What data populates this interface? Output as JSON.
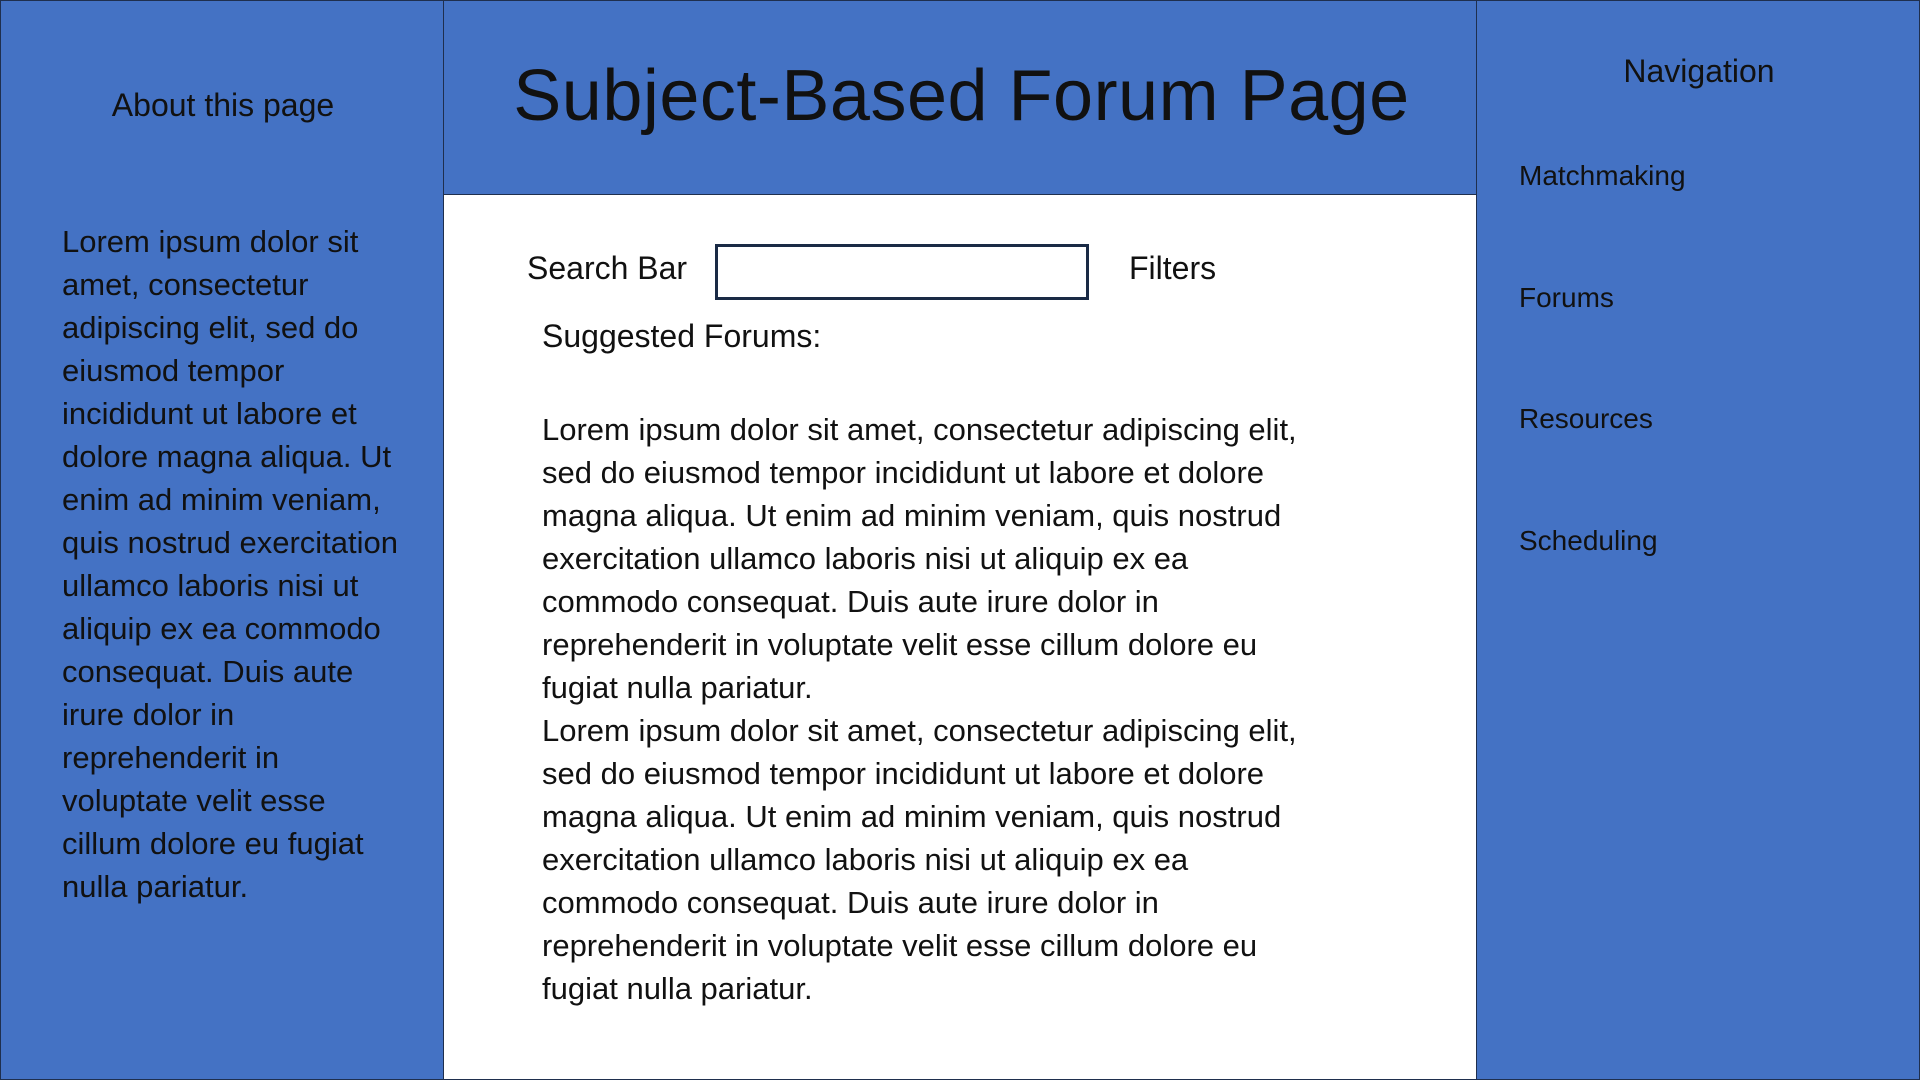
{
  "left_panel": {
    "title": "About this page",
    "body": "Lorem ipsum dolor sit amet, consectetur adipiscing elit, sed do eiusmod tempor incididunt ut labore et dolore magna aliqua. Ut enim ad minim veniam, quis nostrud exercitation ullamco laboris nisi ut aliquip ex ea commodo consequat. Duis aute irure dolor in reprehenderit in voluptate velit esse cillum dolore eu fugiat nulla pariatur."
  },
  "header": {
    "title": "Subject-Based Forum Page"
  },
  "main": {
    "search_label": "Search Bar",
    "search_value": "",
    "filters_label": "Filters",
    "suggested_heading": "Suggested Forums:",
    "suggested_items": [
      "Lorem ipsum dolor sit amet, consectetur adipiscing elit, sed do eiusmod tempor incididunt ut labore et dolore magna aliqua. Ut enim ad minim veniam, quis nostrud exercitation ullamco laboris nisi ut aliquip ex ea commodo consequat. Duis aute irure dolor in reprehenderit in voluptate velit esse cillum dolore eu fugiat nulla pariatur.",
      "Lorem ipsum dolor sit amet, consectetur adipiscing elit, sed do eiusmod tempor incididunt ut labore et dolore magna aliqua. Ut enim ad minim veniam, quis nostrud exercitation ullamco laboris nisi ut aliquip ex ea commodo consequat. Duis aute irure dolor in reprehenderit in voluptate velit esse cillum dolore eu fugiat nulla pariatur."
    ]
  },
  "navigation": {
    "title": "Navigation",
    "items": [
      {
        "label": "Matchmaking"
      },
      {
        "label": "Forums"
      },
      {
        "label": "Resources"
      },
      {
        "label": "Scheduling"
      }
    ]
  },
  "colors": {
    "panel_blue": "#4472c4",
    "border": "#1f2f4e",
    "content_background": "#ffffff"
  }
}
